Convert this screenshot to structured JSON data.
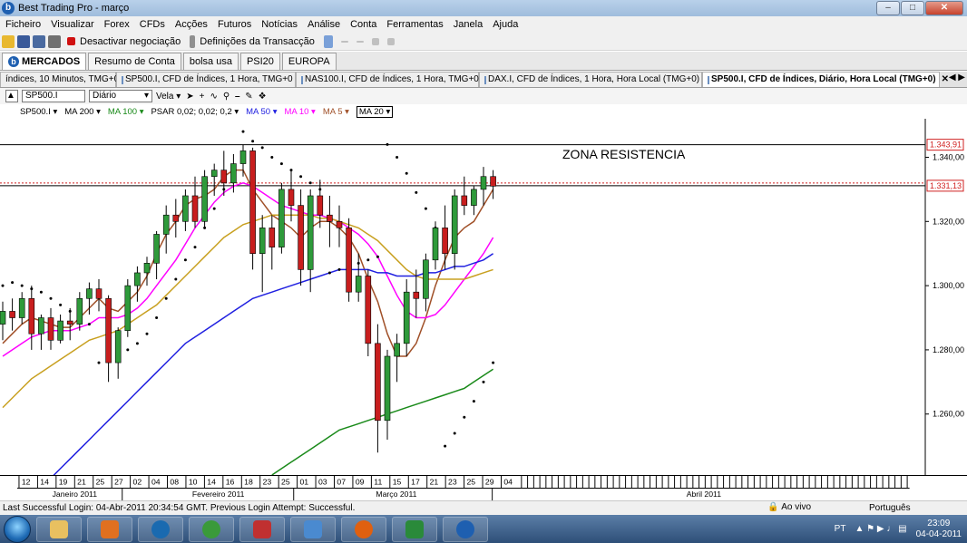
{
  "window": {
    "title": "Best Trading Pro - março",
    "app_logo": "b",
    "min": "–",
    "max": "□",
    "close": "✕"
  },
  "menu": [
    "Ficheiro",
    "Visualizar",
    "Forex",
    "CFDs",
    "Acções",
    "Futuros",
    "Notícias",
    "Análise",
    "Conta",
    "Ferramentas",
    "Janela",
    "Ajuda"
  ],
  "toolbar": {
    "deactivate": "Desactivar negociação",
    "settings": "Definições da Transacção"
  },
  "main_tabs": [
    "MERCADOS",
    "Resumo de Conta",
    "bolsa usa",
    "PSI20",
    "EUROPA"
  ],
  "chart_tabs": [
    {
      "label": "índices, 10 Minutos, TMG+0"
    },
    {
      "label": "SP500.I, CFD de Índices, 1 Hora, TMG+0"
    },
    {
      "label": "NAS100.I, CFD de Índices, 1 Hora, TMG+0"
    },
    {
      "label": "DAX.I, CFD de Índices, 1 Hora, Hora Local (TMG+0)"
    },
    {
      "label": "SP500.I, CFD de Índices, Diário, Hora Local (TMG+0)",
      "close": "✕"
    }
  ],
  "chart_toolbar": {
    "symbol": "SP500.I",
    "period": "Diário",
    "style": "Vela"
  },
  "indicators": [
    "SP500.I ▾",
    "MA 200 ▾",
    "MA 100 ▾",
    "PSAR 0,02; 0,02; 0,2 ▾",
    "MA 50 ▾",
    "MA 10 ▾",
    "MA 5 ▾",
    "MA 20 ▾"
  ],
  "indicator_colors": [
    "#000000",
    "#000000",
    "#1a8a1a",
    "#000000",
    "#2020e0",
    "#ff00ff",
    "#a05028",
    "#000000"
  ],
  "chart_data": {
    "type": "candlestick",
    "symbol": "SP500.I",
    "annotation": "ZONA RESISTENCIA",
    "price_labels": [
      "1.343,91",
      "1.331,13"
    ],
    "y_ticks": [
      "1.340,00",
      "1.320,00",
      "1.300,00",
      "1.280,00",
      "1.260,00"
    ],
    "y_tick_values": [
      1340,
      1320,
      1300,
      1280,
      1260
    ],
    "resistance_levels": [
      1343.91,
      1331.13
    ],
    "ylim": [
      1241,
      1352
    ],
    "x_day_labels": [
      "12",
      "14",
      "19",
      "21",
      "25",
      "27",
      "02",
      "04",
      "08",
      "10",
      "14",
      "16",
      "18",
      "23",
      "25",
      "01",
      "03",
      "07",
      "09",
      "11",
      "15",
      "17",
      "21",
      "23",
      "25",
      "29",
      "04"
    ],
    "x_month_labels": [
      "Janeiro 2011",
      "Fevereiro 2011",
      "Março 2011",
      "Abril 2011"
    ],
    "candles": [
      [
        1288,
        1295,
        1283,
        1292
      ],
      [
        1292,
        1296,
        1286,
        1290
      ],
      [
        1290,
        1298,
        1288,
        1296
      ],
      [
        1296,
        1300,
        1280,
        1285
      ],
      [
        1285,
        1291,
        1280,
        1290
      ],
      [
        1290,
        1293,
        1280,
        1283
      ],
      [
        1283,
        1291,
        1282,
        1289
      ],
      [
        1289,
        1293,
        1283,
        1288
      ],
      [
        1288,
        1298,
        1286,
        1296
      ],
      [
        1296,
        1301,
        1291,
        1299
      ],
      [
        1299,
        1302,
        1292,
        1296
      ],
      [
        1296,
        1297,
        1270,
        1276
      ],
      [
        1276,
        1287,
        1271,
        1286
      ],
      [
        1286,
        1302,
        1284,
        1300
      ],
      [
        1300,
        1306,
        1295,
        1304
      ],
      [
        1304,
        1309,
        1300,
        1307
      ],
      [
        1307,
        1317,
        1302,
        1316
      ],
      [
        1316,
        1325,
        1310,
        1322
      ],
      [
        1322,
        1327,
        1315,
        1320
      ],
      [
        1320,
        1330,
        1317,
        1328
      ],
      [
        1328,
        1334,
        1318,
        1320
      ],
      [
        1320,
        1336,
        1318,
        1334
      ],
      [
        1334,
        1338,
        1328,
        1336
      ],
      [
        1336,
        1342,
        1328,
        1332
      ],
      [
        1332,
        1341,
        1329,
        1338
      ],
      [
        1338,
        1344,
        1334,
        1342
      ],
      [
        1342,
        1343,
        1305,
        1310
      ],
      [
        1310,
        1322,
        1298,
        1318
      ],
      [
        1318,
        1322,
        1305,
        1312
      ],
      [
        1312,
        1332,
        1310,
        1330
      ],
      [
        1330,
        1336,
        1320,
        1325
      ],
      [
        1325,
        1330,
        1300,
        1305
      ],
      [
        1305,
        1330,
        1298,
        1328
      ],
      [
        1328,
        1333,
        1318,
        1322
      ],
      [
        1322,
        1328,
        1312,
        1320
      ],
      [
        1320,
        1325,
        1312,
        1318
      ],
      [
        1318,
        1321,
        1295,
        1298
      ],
      [
        1298,
        1310,
        1295,
        1303
      ],
      [
        1303,
        1305,
        1278,
        1282
      ],
      [
        1282,
        1288,
        1248,
        1258
      ],
      [
        1258,
        1280,
        1252,
        1278
      ],
      [
        1278,
        1285,
        1270,
        1282
      ],
      [
        1282,
        1302,
        1278,
        1298
      ],
      [
        1298,
        1305,
        1290,
        1296
      ],
      [
        1296,
        1310,
        1292,
        1308
      ],
      [
        1308,
        1320,
        1305,
        1318
      ],
      [
        1318,
        1325,
        1305,
        1310
      ],
      [
        1310,
        1330,
        1305,
        1328
      ],
      [
        1328,
        1334,
        1322,
        1325
      ],
      [
        1325,
        1331,
        1322,
        1330
      ],
      [
        1330,
        1337,
        1325,
        1334
      ],
      [
        1334,
        1336,
        1327,
        1331
      ]
    ],
    "ma_series": [
      {
        "name": "MA 5",
        "color": "#a05028",
        "values": [
          1282,
          1285,
          1288,
          1290,
          1289,
          1288,
          1287,
          1287,
          1290,
          1293,
          1296,
          1293,
          1292,
          1295,
          1298,
          1303,
          1310,
          1316,
          1320,
          1325,
          1327,
          1328,
          1330,
          1334,
          1336,
          1336,
          1330,
          1326,
          1322,
          1320,
          1318,
          1315,
          1318,
          1320,
          1320,
          1318,
          1315,
          1310,
          1302,
          1295,
          1285,
          1278,
          1278,
          1282,
          1290,
          1300,
          1308,
          1315,
          1318,
          1320,
          1325,
          1330
        ]
      },
      {
        "name": "MA 10",
        "color": "#ff00ff",
        "values": [
          1278,
          1280,
          1282,
          1284,
          1285,
          1286,
          1286,
          1286,
          1287,
          1288,
          1290,
          1290,
          1290,
          1291,
          1293,
          1296,
          1300,
          1304,
          1308,
          1313,
          1318,
          1322,
          1326,
          1329,
          1331,
          1332,
          1331,
          1329,
          1327,
          1325,
          1324,
          1323,
          1322,
          1322,
          1321,
          1320,
          1318,
          1316,
          1313,
          1309,
          1303,
          1297,
          1292,
          1290,
          1290,
          1291,
          1294,
          1298,
          1302,
          1306,
          1310,
          1315
        ]
      },
      {
        "name": "MA 20",
        "color": "#c8a020",
        "values": [
          1262,
          1265,
          1268,
          1271,
          1273,
          1275,
          1277,
          1279,
          1281,
          1283,
          1284,
          1285,
          1286,
          1288,
          1290,
          1292,
          1294,
          1297,
          1300,
          1303,
          1306,
          1309,
          1312,
          1315,
          1317,
          1319,
          1320,
          1321,
          1322,
          1322,
          1322,
          1322,
          1322,
          1321,
          1321,
          1320,
          1319,
          1318,
          1316,
          1314,
          1311,
          1308,
          1305,
          1303,
          1302,
          1302,
          1302,
          1302,
          1302,
          1303,
          1304,
          1305
        ]
      },
      {
        "name": "MA 50",
        "color": "#2020e0",
        "values": [
          1225,
          1228,
          1231,
          1234,
          1237,
          1240,
          1243,
          1246,
          1249,
          1252,
          1255,
          1258,
          1261,
          1264,
          1267,
          1270,
          1273,
          1276,
          1279,
          1282,
          1284,
          1286,
          1288,
          1290,
          1292,
          1294,
          1296,
          1297,
          1298,
          1299,
          1300,
          1301,
          1302,
          1303,
          1304,
          1305,
          1305,
          1305,
          1305,
          1304,
          1304,
          1303,
          1303,
          1303,
          1304,
          1304,
          1305,
          1306,
          1306,
          1307,
          1308,
          1310
        ]
      },
      {
        "name": "MA 100",
        "color": "#1a8a1a",
        "values": [
          null,
          null,
          null,
          null,
          null,
          null,
          null,
          null,
          null,
          null,
          null,
          null,
          null,
          null,
          null,
          null,
          null,
          null,
          null,
          null,
          null,
          null,
          null,
          null,
          null,
          null,
          null,
          null,
          1241,
          1243,
          1245,
          1247,
          1249,
          1251,
          1253,
          1255,
          1256,
          1257,
          1258,
          1259,
          1260,
          1261,
          1262,
          1263,
          1264,
          1265,
          1266,
          1267,
          1268,
          1270,
          1272,
          1274
        ]
      }
    ],
    "psar": [
      1300,
      1301,
      1300,
      1299,
      1298,
      1296,
      1294,
      1292,
      1290,
      1288,
      1276,
      1277,
      1279,
      1280,
      1282,
      1285,
      1290,
      1296,
      1302,
      1308,
      1312,
      1318,
      1324,
      1330,
      1336,
      1348,
      1345,
      1343,
      1340,
      1338,
      1336,
      1334,
      1332,
      1330,
      1304,
      1305,
      1306,
      1307,
      1308,
      1309,
      1344,
      1340,
      1335,
      1329,
      1324,
      1318,
      1250,
      1254,
      1259,
      1264,
      1270,
      1276
    ]
  },
  "status": {
    "login": "Last Successful Login: 04-Abr-2011 20:34:54 GMT. Previous Login Attempt: Successful.",
    "live": "Ao vivo",
    "language": "Português"
  },
  "taskbar": {
    "lang": "PT",
    "time": "23:09",
    "date": "04-04-2011"
  }
}
